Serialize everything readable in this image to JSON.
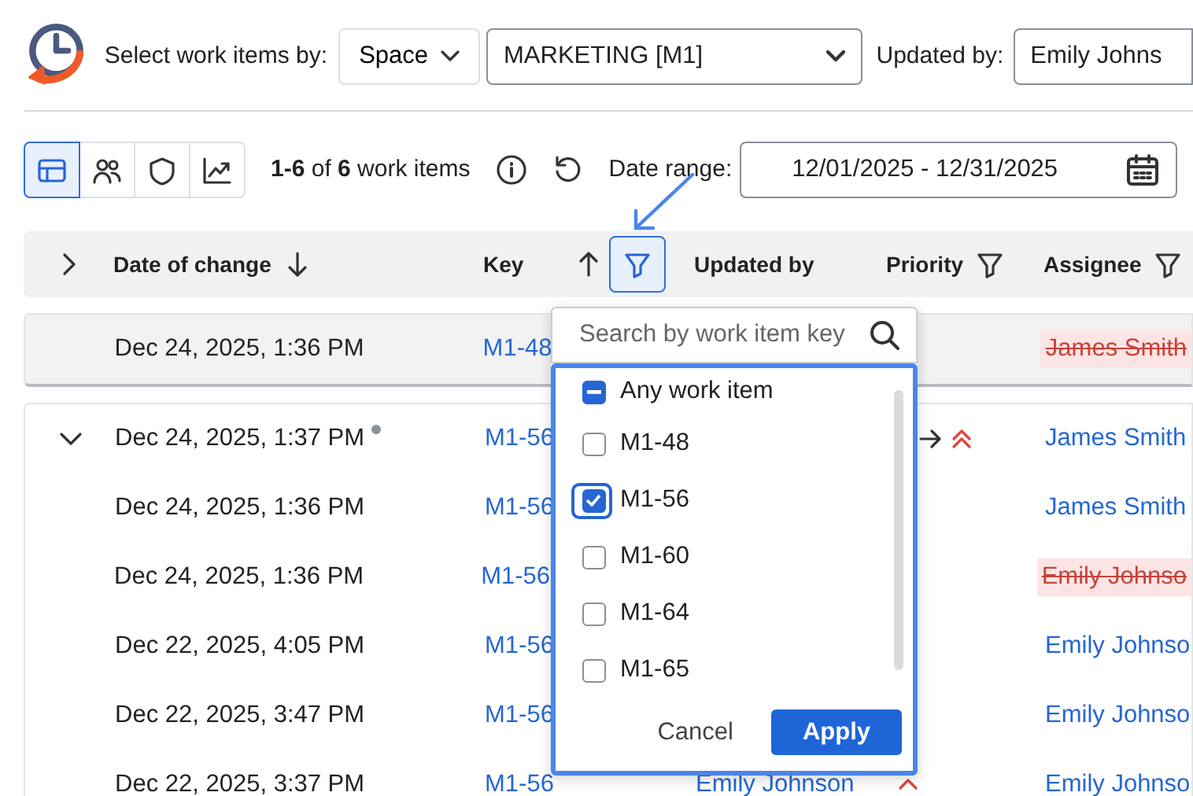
{
  "header": {
    "select_label": "Select work items by:",
    "mode": "Space",
    "space": "MARKETING [M1]",
    "updated_by_label": "Updated by:",
    "updated_by": "Emily Johns"
  },
  "toolbar": {
    "views": [
      {
        "kind": "table",
        "selected": true
      },
      {
        "kind": "people",
        "selected": false
      },
      {
        "kind": "shield",
        "selected": false
      },
      {
        "kind": "chart",
        "selected": false
      }
    ],
    "count": "**1-6** of **6** work items",
    "date_label": "Date range:",
    "date_range": "12/01/2025 - 12/31/2025"
  },
  "table": {
    "columns": [
      {
        "label": "Date of change",
        "sort_descending": true
      },
      {
        "label": "Key",
        "sort_descending": false,
        "filter_active": true
      },
      {
        "label": "Updated by"
      },
      {
        "label": "Priority",
        "filter_active": false
      },
      {
        "label": "Assignee",
        "filter_active": false
      }
    ],
    "groups": [
      {
        "highlighted": true,
        "rows": [
          {
            "date": "Dec 24, 2025, 1:36 PM",
            "key": "M1-48",
            "assignee": "James Smith",
            "assignee_removed": true
          }
        ]
      },
      {
        "highlighted": false,
        "expanded": true,
        "rows": [
          {
            "date": "Dec 24, 2025, 1:37 PM",
            "new": true,
            "key": "M1-56",
            "priority_highest": true,
            "priority_changed": true,
            "assignee": "James Smith",
            "assignee_removed": false
          },
          {
            "date": "Dec 24, 2025, 1:36 PM",
            "new": false,
            "key": "M1-56",
            "assignee": "James Smith",
            "assignee_removed": false
          },
          {
            "date": "Dec 24, 2025, 1:36 PM",
            "new": false,
            "key": "M1-56",
            "assignee": "Emily Johnso",
            "assignee_removed": true
          },
          {
            "date": "Dec 22, 2025, 4:05 PM",
            "new": false,
            "key": "M1-56",
            "assignee": "Emily Johnso",
            "assignee_removed": false
          },
          {
            "date": "Dec 22, 2025, 3:47 PM",
            "new": false,
            "key": "M1-56",
            "assignee": "Emily Johnso",
            "assignee_removed": false
          },
          {
            "date": "Dec 22, 2025, 3:37 PM",
            "new": false,
            "key": "M1-56",
            "updated_by": "Emily Johnson",
            "priority_highest": false,
            "priority_changed": false,
            "assignee": "Emily Johnso",
            "assignee_removed": false
          }
        ]
      }
    ]
  },
  "key_filter": {
    "search_placeholder": "Search by work item key",
    "options": [
      {
        "label": "Any work item",
        "kind": "all",
        "checked": false,
        "indeterminate": true,
        "focused": false
      },
      {
        "label": "M1-48",
        "kind": "item",
        "checked": false,
        "focused": false
      },
      {
        "label": "M1-56",
        "kind": "item",
        "checked": true,
        "focused": true
      },
      {
        "label": "M1-60",
        "kind": "item",
        "checked": false,
        "focused": false
      },
      {
        "label": "M1-64",
        "kind": "item",
        "checked": false,
        "focused": false
      },
      {
        "label": "M1-65",
        "kind": "item",
        "checked": false,
        "focused": false
      }
    ],
    "cancel": "Cancel",
    "apply": "Apply"
  }
}
